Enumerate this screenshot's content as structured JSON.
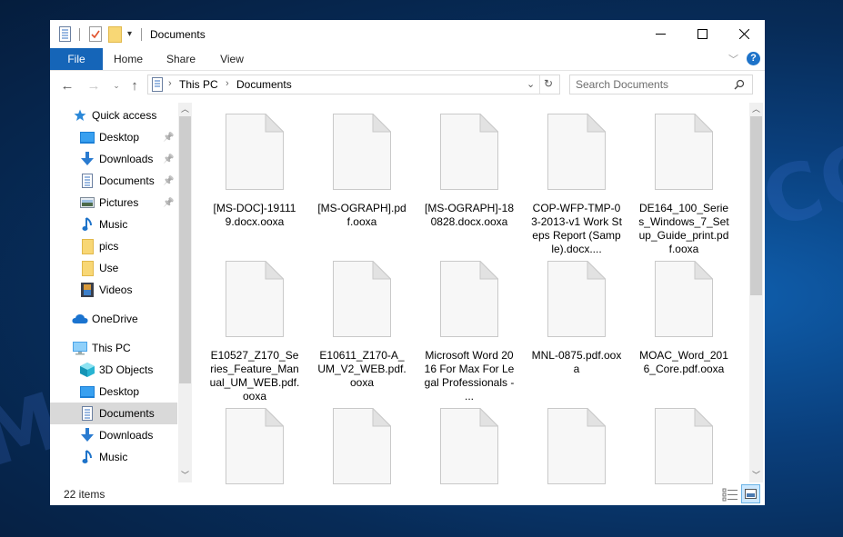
{
  "window": {
    "title": "Documents",
    "controls": {
      "minimize": "—",
      "maximize": "☐",
      "close": "✕"
    }
  },
  "ribbon": {
    "tabs": [
      {
        "label": "File",
        "active": true
      },
      {
        "label": "Home"
      },
      {
        "label": "Share"
      },
      {
        "label": "View"
      }
    ],
    "help_icon": "?"
  },
  "navigation": {
    "breadcrumb": [
      "This PC",
      "Documents"
    ],
    "search_placeholder": "Search Documents"
  },
  "sidebar": {
    "items": [
      {
        "label": "Quick access",
        "icon": "star-icon",
        "level": 0
      },
      {
        "label": "Desktop",
        "icon": "desktop-icon",
        "level": 1,
        "pinned": true
      },
      {
        "label": "Downloads",
        "icon": "download-icon",
        "level": 1,
        "pinned": true
      },
      {
        "label": "Documents",
        "icon": "document-icon",
        "level": 1,
        "pinned": true
      },
      {
        "label": "Pictures",
        "icon": "pictures-icon",
        "level": 1,
        "pinned": true
      },
      {
        "label": "Music",
        "icon": "music-icon",
        "level": 1
      },
      {
        "label": "pics",
        "icon": "folder-icon",
        "level": 1
      },
      {
        "label": "Use",
        "icon": "folder-icon",
        "level": 1
      },
      {
        "label": "Videos",
        "icon": "videos-icon",
        "level": 1
      },
      {
        "label": "OneDrive",
        "icon": "cloud-icon",
        "level": 0
      },
      {
        "label": "This PC",
        "icon": "computer-icon",
        "level": 0
      },
      {
        "label": "3D Objects",
        "icon": "cube-icon",
        "level": 1
      },
      {
        "label": "Desktop",
        "icon": "desktop-icon",
        "level": 1
      },
      {
        "label": "Documents",
        "icon": "document-icon",
        "level": 1,
        "selected": true
      },
      {
        "label": "Downloads",
        "icon": "download-icon",
        "level": 1
      },
      {
        "label": "Music",
        "icon": "music-icon",
        "level": 1
      }
    ]
  },
  "files": [
    {
      "name": "[MS-DOC]-191119.docx.ooxa"
    },
    {
      "name": "[MS-OGRAPH].pdf.ooxa"
    },
    {
      "name": "[MS-OGRAPH]-180828.docx.ooxa"
    },
    {
      "name": "COP-WFP-TMP-03-2013-v1 Work Steps Report (Sample).docx...."
    },
    {
      "name": "DE164_100_Series_Windows_7_Setup_Guide_print.pdf.ooxa"
    },
    {
      "name": "E10527_Z170_Series_Feature_Manual_UM_WEB.pdf.ooxa"
    },
    {
      "name": "E10611_Z170-A_UM_V2_WEB.pdf.ooxa"
    },
    {
      "name": "Microsoft Word 2016 For Max For Legal Professionals - ..."
    },
    {
      "name": "MNL-0875.pdf.ooxa"
    },
    {
      "name": "MOAC_Word_2016_Core.pdf.ooxa"
    },
    {
      "name": ""
    },
    {
      "name": ""
    },
    {
      "name": ""
    },
    {
      "name": ""
    },
    {
      "name": ""
    }
  ],
  "status": {
    "item_count": "22 items"
  },
  "watermark": "MYANTISPYWARE.COM",
  "colors": {
    "accent": "#1565b8",
    "selected": "#d9d9d9",
    "help": "#1e73c9"
  }
}
